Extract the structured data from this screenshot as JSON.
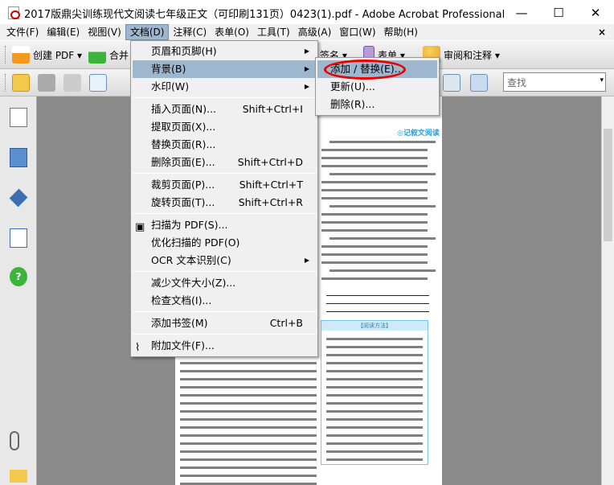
{
  "window": {
    "title": "2017版鼎尖训练现代文阅读七年级正文（可印刷131页）0423(1).pdf - Adobe Acrobat Professional",
    "minimize": "—",
    "maximize": "☐",
    "close": "✕"
  },
  "menubar": {
    "items": [
      "文件(F)",
      "编辑(E)",
      "视图(V)",
      "文档(D)",
      "注释(C)",
      "表单(O)",
      "工具(T)",
      "高级(A)",
      "窗口(W)",
      "帮助(H)"
    ],
    "close": "×"
  },
  "toolbar1": {
    "create_pdf": "创建 PDF ▾",
    "merge": "合并",
    "sign": "签名 ▾",
    "forms": "表单 ▾",
    "review": "审阅和注释 ▾"
  },
  "toolbar2": {
    "search_placeholder": "查找",
    "dropdown": "▾"
  },
  "document_menu": {
    "items": [
      {
        "label": "页眉和页脚(H)",
        "shortcut": "",
        "submenu": true
      },
      {
        "label": "背景(B)",
        "shortcut": "",
        "submenu": true
      },
      {
        "label": "水印(W)",
        "shortcut": "",
        "submenu": true
      },
      {
        "label": "插入页面(N)...",
        "shortcut": "Shift+Ctrl+I"
      },
      {
        "label": "提取页面(X)...",
        "shortcut": ""
      },
      {
        "label": "替换页面(R)...",
        "shortcut": ""
      },
      {
        "label": "删除页面(E)...",
        "shortcut": "Shift+Ctrl+D"
      },
      {
        "label": "裁剪页面(P)...",
        "shortcut": "Shift+Ctrl+T"
      },
      {
        "label": "旋转页面(T)...",
        "shortcut": "Shift+Ctrl+R"
      },
      {
        "label": "扫描为 PDF(S)...",
        "shortcut": ""
      },
      {
        "label": "优化扫描的 PDF(O)",
        "shortcut": ""
      },
      {
        "label": "OCR 文本识别(C)",
        "shortcut": "",
        "submenu": true
      },
      {
        "label": "减少文件大小(Z)...",
        "shortcut": ""
      },
      {
        "label": "检查文档(I)...",
        "shortcut": ""
      },
      {
        "label": "添加书签(M)",
        "shortcut": "Ctrl+B"
      },
      {
        "label": "附加文件(F)...",
        "shortcut": ""
      }
    ],
    "submenu_arrow": "▶"
  },
  "background_submenu": {
    "items": [
      "添加 / 替换(E)...",
      "更新(U)...",
      "删除(R)..."
    ]
  },
  "page": {
    "header": "◎记叙文阅读",
    "box_title": "【阅读方法】"
  },
  "colors": {
    "highlight": "#9eb6ce",
    "annotation": "#e00000",
    "accent": "#2aa0d8"
  }
}
